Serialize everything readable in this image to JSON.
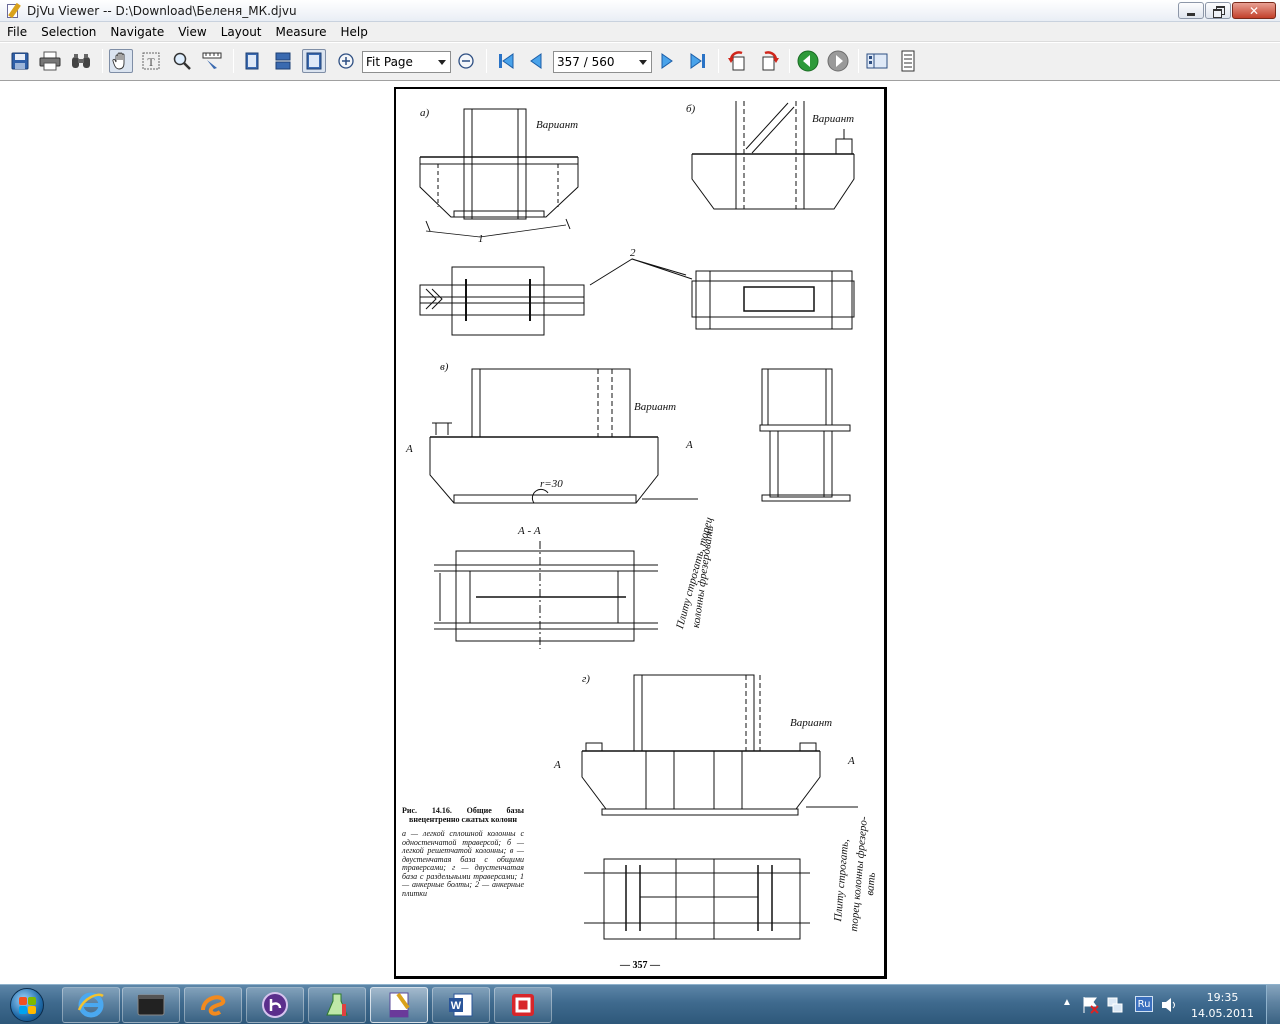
{
  "window": {
    "title": "DjVu Viewer -- D:\\Download\\Беленя_МК.djvu"
  },
  "menu": [
    "File",
    "Selection",
    "Navigate",
    "View",
    "Layout",
    "Measure",
    "Help"
  ],
  "toolbar": {
    "zoom_value": "Fit Page",
    "page_value": "357 / 560"
  },
  "document": {
    "labels": {
      "a": "а)",
      "b": "б)",
      "v": "в)",
      "g": "г)",
      "variant_a": "Вариант",
      "variant_b": "Вариант",
      "variant_v": "Вариант",
      "variant_g": "Вариант",
      "callout_1": "1",
      "callout_2": "2",
      "section_aa": "А - А",
      "radius": "r=30",
      "section_mark_a1": "А",
      "section_mark_a2": "А",
      "section_mark_a3": "А",
      "section_mark_a4": "А",
      "note_v_1": "Плиту строгать, торец",
      "note_v_2": "колонны фрезеровать",
      "note_g_1": "Плиту строгать,",
      "note_g_2": "торец колонны фрезеро-",
      "note_g_3": "вать"
    },
    "caption": {
      "title": "Рис. 14.16. Общие базы внецентренно сжатых колонн",
      "body": "а — легкой сплошной колонны с одностенчатой траверсой; б — легкой решетчатой колонны; в — двустенчатая база с общими траверсами; г — двустенчатая база с раздельными траверсами; 1 — анкерные болты; 2 — анкерные плитки"
    },
    "page_number": "— 357 —"
  },
  "taskbar": {
    "language": "Ru",
    "time": "19:35",
    "date": "14.05.2011"
  }
}
